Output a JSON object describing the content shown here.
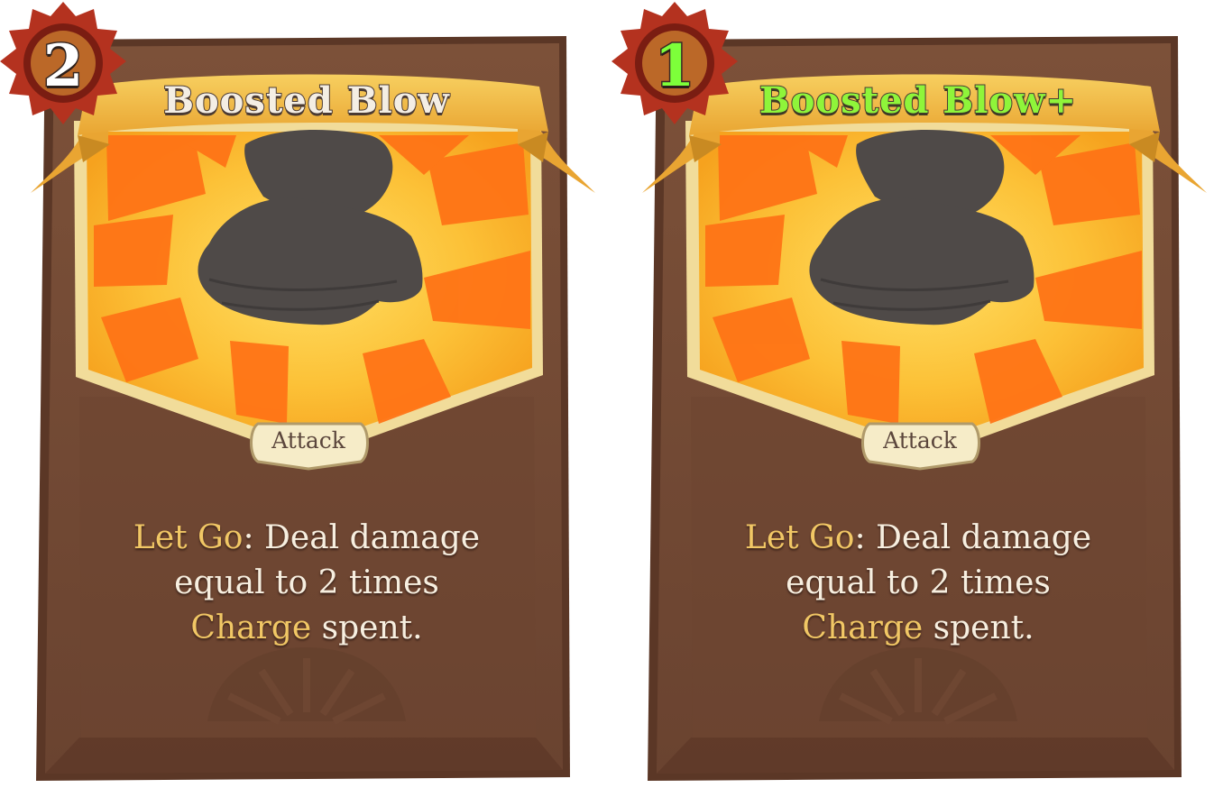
{
  "cards": [
    {
      "cost": "2",
      "name": "Boosted Blow",
      "upgraded": false,
      "type": "Attack",
      "description": {
        "keyword1": "Let Go",
        "text1": ": Deal damage",
        "text2": "equal to 2 times",
        "keyword2": "Charge",
        "text3": " spent."
      }
    },
    {
      "cost": "1",
      "name": "Boosted Blow+",
      "upgraded": true,
      "type": "Attack",
      "description": {
        "keyword1": "Let Go",
        "text1": ": Deal damage",
        "text2": "equal to 2 times",
        "keyword2": "Charge",
        "text3": " spent."
      }
    }
  ],
  "colors": {
    "card_frame": "#6b4330",
    "card_body": "#744b36",
    "banner": "#f0b541",
    "art_background": "#fbb92a",
    "art_rays": "#ff7318",
    "silhouette": "#4f4a48",
    "cost_gear": "#b5341f",
    "keyword": "#f1c765",
    "upgraded_text": "#8ff53a"
  },
  "icons": {
    "cost": "cost-gear-icon",
    "art": "fist-silhouette-icon",
    "emblem": "faded-emblem-icon"
  }
}
